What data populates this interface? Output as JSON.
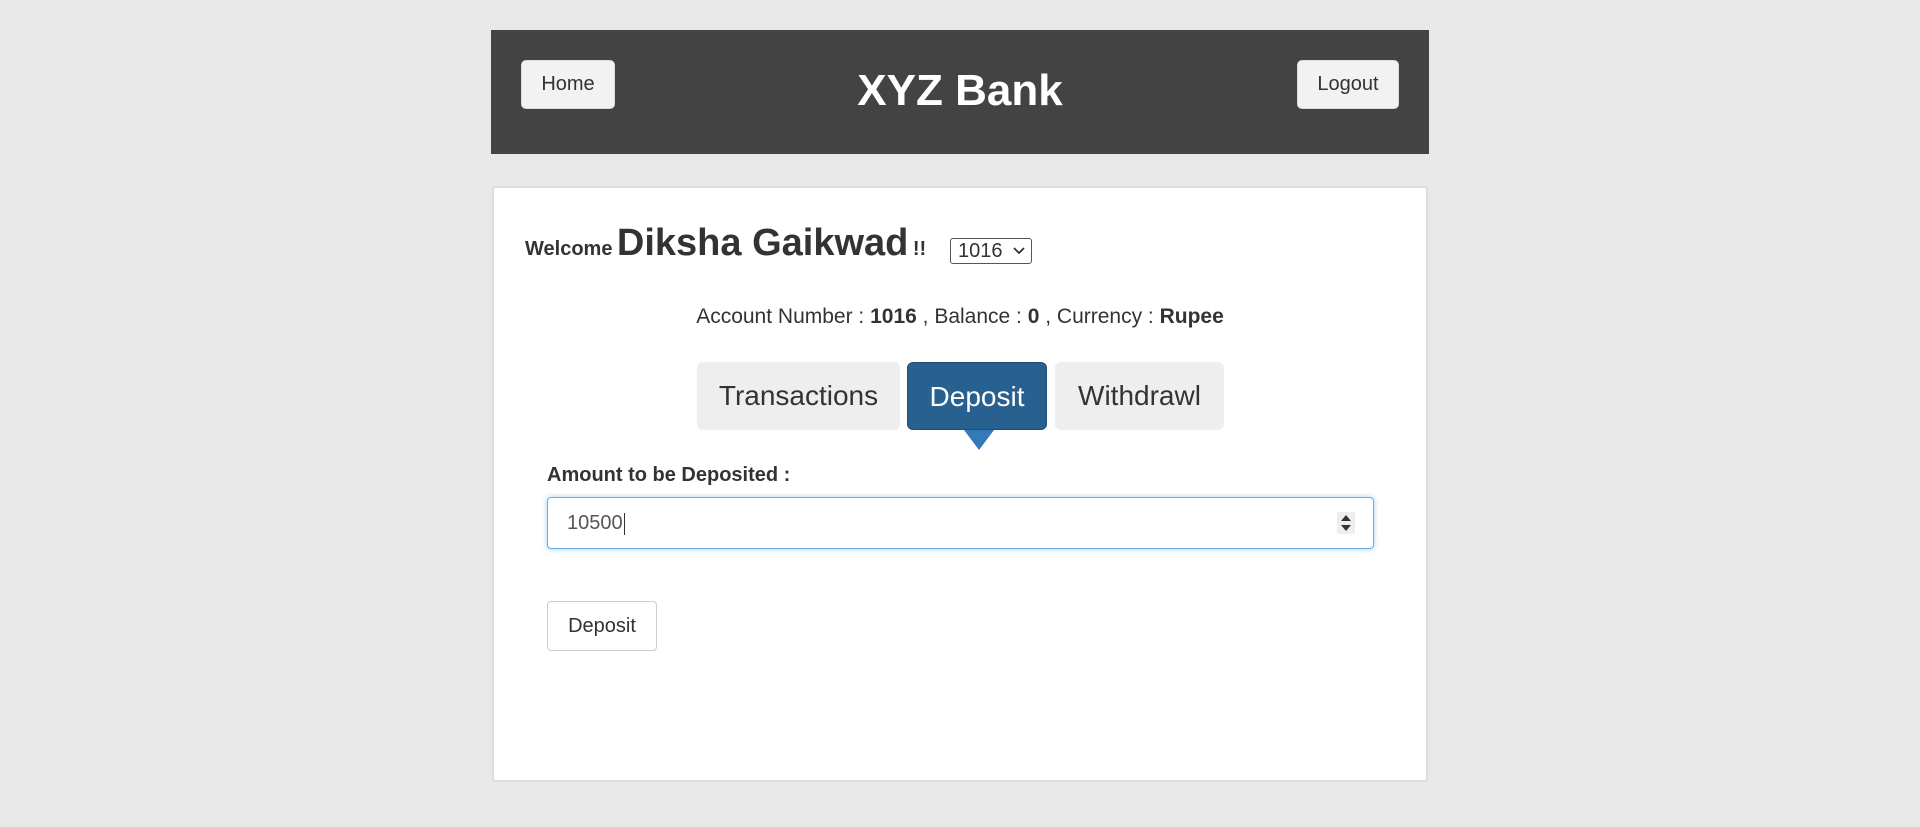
{
  "header": {
    "home_label": "Home",
    "title": "XYZ Bank",
    "logout_label": "Logout"
  },
  "welcome": {
    "prefix": "Welcome",
    "user_name": "Diksha Gaikwad",
    "suffix": "!!"
  },
  "account_select": {
    "selected": "1016"
  },
  "account_info": {
    "number_label": "Account Number : ",
    "number": "1016",
    "balance_label": " , Balance : ",
    "balance": "0",
    "currency_label": " , Currency : ",
    "currency": "Rupee"
  },
  "tabs": [
    {
      "label": "Transactions",
      "active": false
    },
    {
      "label": "Deposit",
      "active": true
    },
    {
      "label": "Withdrawl",
      "active": false
    }
  ],
  "deposit_form": {
    "amount_label": "Amount to be Deposited :",
    "amount_value": "10500",
    "submit_label": "Deposit"
  },
  "colors": {
    "header_bg": "#434343",
    "active_tab": "#286090",
    "page_bg": "#e8e8e8"
  }
}
